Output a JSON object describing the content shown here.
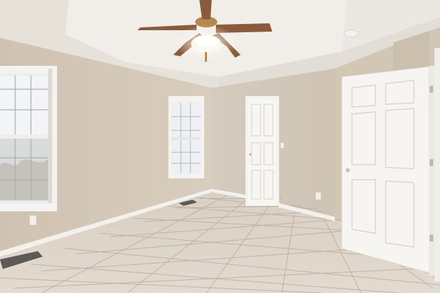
{
  "scene": {
    "room": "empty bedroom",
    "colors": {
      "wall": "#d4c8b8",
      "wall_shadow": "#c9bdac",
      "ceiling": "#ece8e2",
      "tray_ceiling": "#f1eee9",
      "floor_tile": "#dcd2c6",
      "grout": "#b9ada0",
      "trim": "#f4f2ee",
      "door": "#f6f5f2",
      "window_light": "#e9eef2"
    },
    "objects": [
      "ceiling-fan",
      "left-window",
      "center-window",
      "closet-door",
      "bedroom-door",
      "floor-vent-left",
      "floor-vent-center",
      "outlet-left",
      "outlet-right",
      "smoke-detector",
      "light-switch"
    ]
  }
}
